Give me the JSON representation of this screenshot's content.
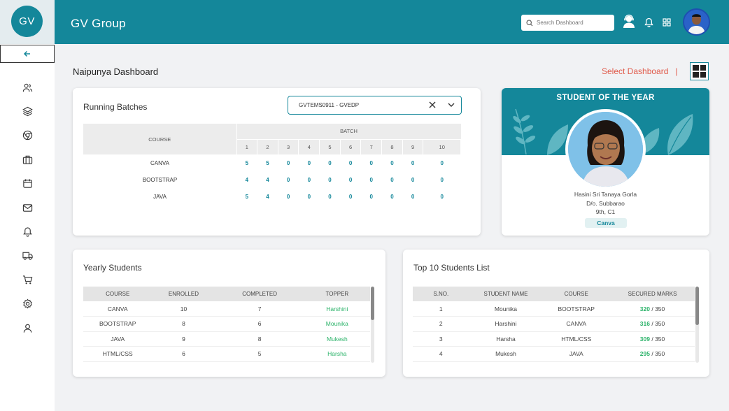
{
  "brand": {
    "logo_text": "GV"
  },
  "header": {
    "title": "GV Group",
    "search_placeholder": "Search Dashboard"
  },
  "sidebar": {
    "items": [
      {
        "icon": "users-icon"
      },
      {
        "icon": "layers-icon"
      },
      {
        "icon": "chrome-icon"
      },
      {
        "icon": "briefcase-icon"
      },
      {
        "icon": "calendar-icon"
      },
      {
        "icon": "mail-icon"
      },
      {
        "icon": "bell-icon"
      },
      {
        "icon": "truck-icon"
      },
      {
        "icon": "cart-icon"
      },
      {
        "icon": "settings-icon"
      },
      {
        "icon": "user-icon"
      }
    ]
  },
  "page": {
    "title": "Naipunya Dashboard",
    "select_dashboard": "Select Dashboard",
    "divider": "|"
  },
  "running_batches": {
    "title": "Running Batches",
    "selected_batch": "GVTEMS0911 - GVEDP",
    "course_header": "COURSE",
    "batch_header": "BATCH",
    "batch_numbers": [
      "1",
      "2",
      "3",
      "4",
      "5",
      "6",
      "7",
      "8",
      "9",
      "10"
    ],
    "rows": [
      {
        "course": "CANVA",
        "values": [
          "5",
          "5",
          "0",
          "0",
          "0",
          "0",
          "0",
          "0",
          "0",
          "0"
        ]
      },
      {
        "course": "BOOTSTRAP",
        "values": [
          "4",
          "4",
          "0",
          "0",
          "0",
          "0",
          "0",
          "0",
          "0",
          "0"
        ]
      },
      {
        "course": "JAVA",
        "values": [
          "5",
          "4",
          "0",
          "0",
          "0",
          "0",
          "0",
          "0",
          "0",
          "0"
        ]
      }
    ]
  },
  "student_of_year": {
    "title": "STUDENT OF THE YEAR",
    "name": "Hasini Sri Tanaya Gorla",
    "parent": "D/o. Subbarao",
    "class": "9th, C1",
    "course": "Canva"
  },
  "yearly_students": {
    "title": "Yearly Students",
    "headers": [
      "COURSE",
      "ENROLLED",
      "COMPLETED",
      "TOPPER"
    ],
    "rows": [
      [
        "CANVA",
        "10",
        "7",
        "Harshini"
      ],
      [
        "BOOTSTRAP",
        "8",
        "6",
        "Mounika"
      ],
      [
        "JAVA",
        "9",
        "8",
        "Mukesh"
      ],
      [
        "HTML/CSS",
        "6",
        "5",
        "Harsha"
      ]
    ]
  },
  "top_students": {
    "title": "Top 10 Students List",
    "headers": [
      "S.NO.",
      "STUDENT NAME",
      "COURSE",
      "SECURED MARKS"
    ],
    "rows": [
      {
        "sno": "1",
        "name": "Mounika",
        "course": "BOOTSTRAP",
        "marks": "320",
        "total": " / 350"
      },
      {
        "sno": "2",
        "name": "Harshini",
        "course": "CANVA",
        "marks": "316",
        "total": " / 350"
      },
      {
        "sno": "3",
        "name": "Harsha",
        "course": "HTML/CSS",
        "marks": "309",
        "total": " / 350"
      },
      {
        "sno": "4",
        "name": "Mukesh",
        "course": "JAVA",
        "marks": "295",
        "total": " / 350"
      }
    ]
  },
  "colors": {
    "primary": "#14879a",
    "accent": "#e05a4a",
    "success": "#2cb36a"
  }
}
